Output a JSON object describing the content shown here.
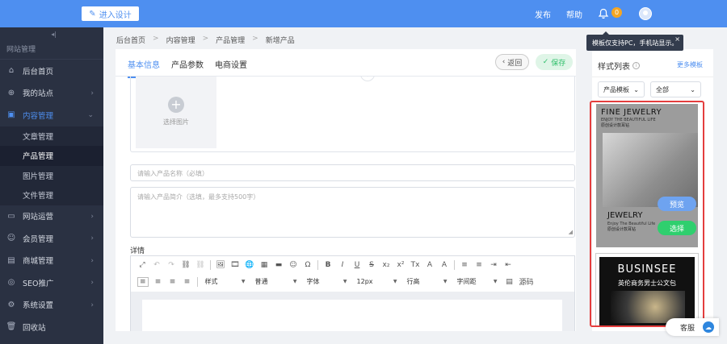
{
  "topbar": {
    "design_button": "进入设计",
    "publish": "发布",
    "help": "帮助",
    "notify_count": "0",
    "accent": "#4e8ff0"
  },
  "sidebar": {
    "collapse_icon": "collapse-icon",
    "section_title": "网站管理",
    "items": [
      {
        "label": "后台首页",
        "icon": "home-icon"
      },
      {
        "label": "我的站点",
        "icon": "globe-icon"
      },
      {
        "label": "内容管理",
        "icon": "shield-icon",
        "active": true
      },
      {
        "label": "网站运营",
        "icon": "monitor-icon"
      },
      {
        "label": "会员管理",
        "icon": "users-icon"
      },
      {
        "label": "商城管理",
        "icon": "shop-icon"
      },
      {
        "label": "SEO推广",
        "icon": "target-icon"
      },
      {
        "label": "系统设置",
        "icon": "gear-icon"
      },
      {
        "label": "回收站",
        "icon": "trash-icon"
      }
    ],
    "sub_items": [
      "文章管理",
      "产品管理",
      "图片管理",
      "文件管理"
    ]
  },
  "breadcrumb": [
    "后台首页",
    "内容管理",
    "产品管理",
    "新增产品"
  ],
  "tabs": [
    "基本信息",
    "产品参数",
    "电商设置"
  ],
  "actions": {
    "back": "返回",
    "save": "保存"
  },
  "form": {
    "pick_image": "选择图片",
    "name_placeholder": "请输入产品名称（必填）",
    "summary_placeholder": "请输入产品简介（选填，最多支持500字）",
    "detail_label": "详情"
  },
  "editor": {
    "toolbar_row1": [
      "⤢",
      "↶",
      "↷",
      "⛓",
      "⛓",
      "🖼",
      "🎞",
      "🌐",
      "▦",
      "▬",
      "☺",
      "Ω",
      "B",
      "I",
      "U",
      "S",
      "x₂",
      "x²",
      "Tx",
      "A",
      "A",
      "≡",
      "≡",
      "⇥",
      "⇤"
    ],
    "dropdowns": [
      "样式",
      "普通",
      "字体",
      "12px",
      "行高",
      "字间距"
    ],
    "source": "源码"
  },
  "right_panel": {
    "title": "样式列表",
    "more": "更多模板",
    "select1": "产品模板",
    "select2": "全部",
    "card1": {
      "line1": "FINE JEWELRY",
      "line2": "ENJOY THE BEAUTIFUL LIFE",
      "line3": "原创设计款耳钻",
      "line4": "JEWELRY",
      "line5": "Enjoy The Beautiful Life",
      "line6": "原创设计款耳钻"
    },
    "card2": {
      "line1": "BUSINSEE",
      "line2": "英伦商务男士公文包"
    },
    "preview": "预览",
    "select": "选择",
    "tooltip": "模板仅支持PC，手机站显示。",
    "tooltip_close": "×"
  },
  "service": "客服"
}
